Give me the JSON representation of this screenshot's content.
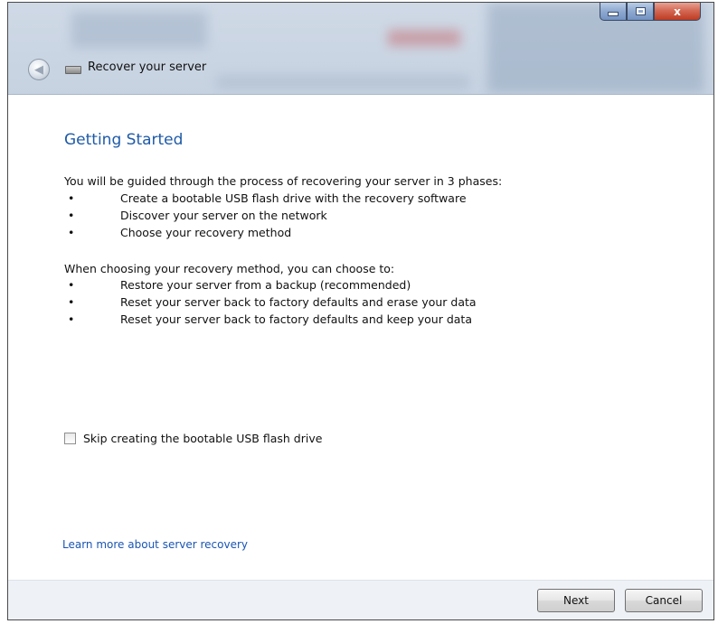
{
  "window": {
    "title": "Recover your server",
    "caption": {
      "minimize_icon": "minimize-icon",
      "maximize_icon": "maximize-icon",
      "close_label": "x"
    }
  },
  "main": {
    "heading": "Getting Started",
    "intro": "You will be guided through the process  of recovering your server in 3 phases:",
    "phases": [
      "Create a bootable USB flash drive with the recovery software",
      "Discover your server on the network",
      "Choose your recovery method"
    ],
    "methods_intro": "When choosing your recovery method, you can choose to:",
    "methods": [
      "Restore your server from a backup (recommended)",
      "Reset your server back to factory defaults and erase your data",
      "Reset your server back to factory defaults and keep your data"
    ],
    "bullet": "•",
    "skip_checkbox": {
      "label": "Skip creating the bootable USB flash drive",
      "checked": false
    },
    "learn_more_link": "Learn more about server recovery"
  },
  "footer": {
    "next_label": "Next",
    "cancel_label": "Cancel"
  }
}
